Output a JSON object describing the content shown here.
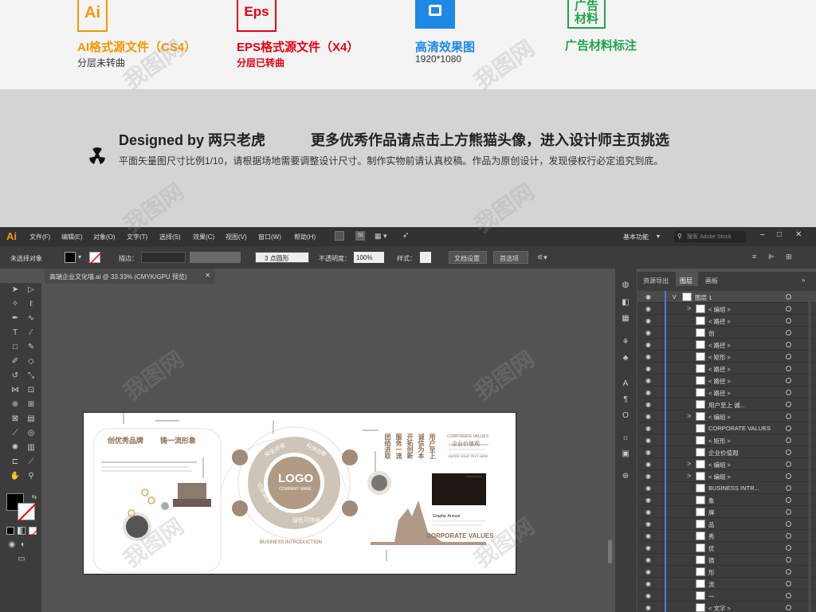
{
  "features": [
    {
      "icon": "Ai",
      "title": "AI格式源文件（CS4）",
      "sub": "分层未转曲",
      "color": "#f39800"
    },
    {
      "icon": "Eps",
      "title": "EPS格式源文件（X4）",
      "sub": "分层已转曲",
      "color": "#e60012"
    },
    {
      "icon": "",
      "title": "高清效果图",
      "sub": "1920*1080",
      "color": "#1e88e5"
    },
    {
      "icon": "广告\n材料",
      "title": "广告材料标注",
      "sub": "",
      "color": "#22a34a"
    }
  ],
  "designer": {
    "name": "Designed by 两只老虎",
    "cta": "更多优秀作品请点击上方熊猫头像，进入设计师主页挑选",
    "note": "平面矢量图尺寸比例1/10，请根据场地需要调整设计尺寸。制作实物前请认真校稿。作品为原创设计，发现侵权行必定追究到底。"
  },
  "app": {
    "logo": "Ai",
    "menu": [
      "文件(F)",
      "编辑(E)",
      "对象(O)",
      "文字(T)",
      "选择(S)",
      "效果(C)",
      "视图(V)",
      "窗口(W)",
      "帮助(H)"
    ],
    "workspace": "基本功能",
    "search_placeholder": "搜索 Adobe Stock",
    "control": {
      "no_selection": "未选择对象",
      "stroke_label": "描边：",
      "brush": "3 点圆形",
      "opacity_label": "不透明度：",
      "opacity": "100%",
      "style_label": "样式：",
      "doc_setup": "文档设置",
      "prefs": "首选项"
    },
    "doc_tab": "高端企业文化墙.ai @ 33.33% (CMYK/GPU 预览)",
    "panel_tabs": [
      "资源导出",
      "图层",
      "画板"
    ],
    "layers": [
      {
        "name": "图层 1",
        "expand": "v"
      },
      {
        "name": "< 编组 >",
        "expand": ">"
      },
      {
        "name": "< 路径 >",
        "expand": ""
      },
      {
        "name": "创",
        "expand": ""
      },
      {
        "name": "< 路径 >",
        "expand": ""
      },
      {
        "name": "< 矩形 >",
        "expand": ""
      },
      {
        "name": "< 路径 >",
        "expand": ""
      },
      {
        "name": "< 路径 >",
        "expand": ""
      },
      {
        "name": "< 路径 >",
        "expand": ""
      },
      {
        "name": "用户至上 诚...",
        "expand": ""
      },
      {
        "name": "< 编组 >",
        "expand": ">"
      },
      {
        "name": "CORPORATE VALUES",
        "expand": ""
      },
      {
        "name": "< 矩形 >",
        "expand": ""
      },
      {
        "name": "企业价值观",
        "expand": ""
      },
      {
        "name": "< 编组 >",
        "expand": ">"
      },
      {
        "name": "< 编组 >",
        "expand": ">"
      },
      {
        "name": "BUSINESS INTR...",
        "expand": ""
      },
      {
        "name": "象",
        "expand": ""
      },
      {
        "name": "牌",
        "expand": ""
      },
      {
        "name": "品",
        "expand": ""
      },
      {
        "name": "秀",
        "expand": ""
      },
      {
        "name": "优",
        "expand": ""
      },
      {
        "name": "铸",
        "expand": ""
      },
      {
        "name": "形",
        "expand": ""
      },
      {
        "name": "流",
        "expand": ""
      },
      {
        "name": "一",
        "expand": ""
      },
      {
        "name": "< 文字 >",
        "expand": ""
      }
    ]
  },
  "artboard": {
    "headline_left": "创优秀品牌",
    "headline_right": "铸一流形象",
    "logo": "LOGO",
    "company": "COMPANY NAME",
    "ring_words": [
      "安全环保",
      "科技创新",
      "优质高效",
      "绿色可持续"
    ],
    "slogans": [
      "用户至上",
      "诚信为本",
      "开拓创新",
      "服务一流",
      "团结进取"
    ],
    "values_en": "CORPORATE VALUES",
    "values_cn": "企业价值观",
    "enter_text": "ENTER YOUR TEXT HERE",
    "annual": "Graphic Annual",
    "business": "BUSINESS INTRODUCTION",
    "corporate_values": "CORPORATE VALUES"
  },
  "watermark": "我图网"
}
